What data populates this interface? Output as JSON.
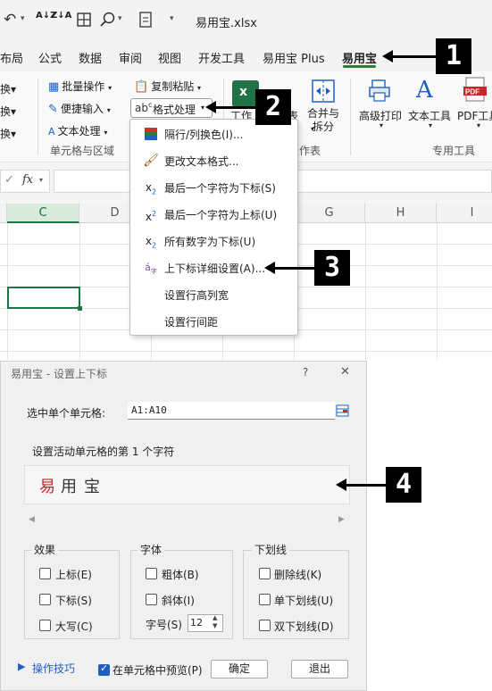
{
  "titlebar": {
    "icons": [
      "undo-icon",
      "sort-asc-icon",
      "sort-desc-icon",
      "table-icon",
      "search-icon",
      "form-icon"
    ],
    "sort_asc": "A↓Z",
    "sort_desc": "Z↓A",
    "file_title": "易用宝.xlsx"
  },
  "tabs": [
    {
      "label": "布局"
    },
    {
      "label": "公式"
    },
    {
      "label": "数据"
    },
    {
      "label": "审阅"
    },
    {
      "label": "视图"
    },
    {
      "label": "开发工具"
    },
    {
      "label": "易用宝 Plus"
    },
    {
      "label": "易用宝",
      "active": true
    }
  ],
  "ribbon": {
    "left_items": [
      "换▾",
      "换▾",
      "换▾"
    ],
    "bulk_ops": "批量操作",
    "copy_paste": "复制粘贴",
    "easy_input": "便捷输入",
    "format_process": "格式处理",
    "text_process": "文本处理",
    "group_cells_area": "单元格与区域",
    "worksheet_partial": "工作",
    "table_partial": "表",
    "merge_split": "合并与\n拆分",
    "group_worksheet": "工作表",
    "advanced_print": "高级打印",
    "text_tools": "文本工具",
    "pdf_tools": "PDF工具",
    "group_special": "专用工具",
    "accent": "#217346"
  },
  "formula_bar": {
    "fx": "fx",
    "value": ""
  },
  "grid": {
    "columns": [
      "C",
      "D",
      "E",
      "F",
      "G",
      "H",
      "I"
    ],
    "selected_column": "C"
  },
  "menu": {
    "items": [
      {
        "icon": "alternate-color-icon",
        "label": "隔行/列换色(I)..."
      },
      {
        "icon": "brush-icon",
        "label": "更改文本格式..."
      },
      {
        "icon": "subscript-icon",
        "label": "最后一个字符为下标(S)"
      },
      {
        "icon": "superscript-icon",
        "label": "最后一个字符为上标(U)"
      },
      {
        "icon": "subscript-icon",
        "label": "所有数字为下标(U)"
      },
      {
        "icon": "sub-sup-settings-icon",
        "label": "上下标详细设置(A)..."
      },
      {
        "icon": "",
        "label": "设置行高列宽"
      },
      {
        "icon": "",
        "label": "设置行间距"
      }
    ]
  },
  "dialog": {
    "title": "易用宝 - 设置上下标",
    "help": "?",
    "close": "✕",
    "select_label": "选中单个单元格:",
    "range_value": "A1:A10",
    "active_cell_text": "设置活动单元格的第 1 个字符",
    "preview_chars": [
      "易",
      "用",
      "宝"
    ],
    "preview_first_color": "#c62828",
    "effects": {
      "title": "效果",
      "superscript": "上标(E)",
      "subscript": "下标(S)",
      "uppercase": "大写(C)"
    },
    "font": {
      "title": "字体",
      "bold": "粗体(B)",
      "italic": "斜体(I)",
      "size_label": "字号(S)",
      "size_value": "12"
    },
    "underline": {
      "title": "下划线",
      "strike": "删除线(K)",
      "single": "单下划线(U)",
      "double": "双下划线(D)"
    },
    "tips": "操作技巧",
    "preview_in_cell": "在单元格中预览(P)",
    "preview_in_cell_checked": true,
    "ok": "确定",
    "exit": "退出"
  },
  "callouts": [
    "1",
    "2",
    "3",
    "4"
  ]
}
